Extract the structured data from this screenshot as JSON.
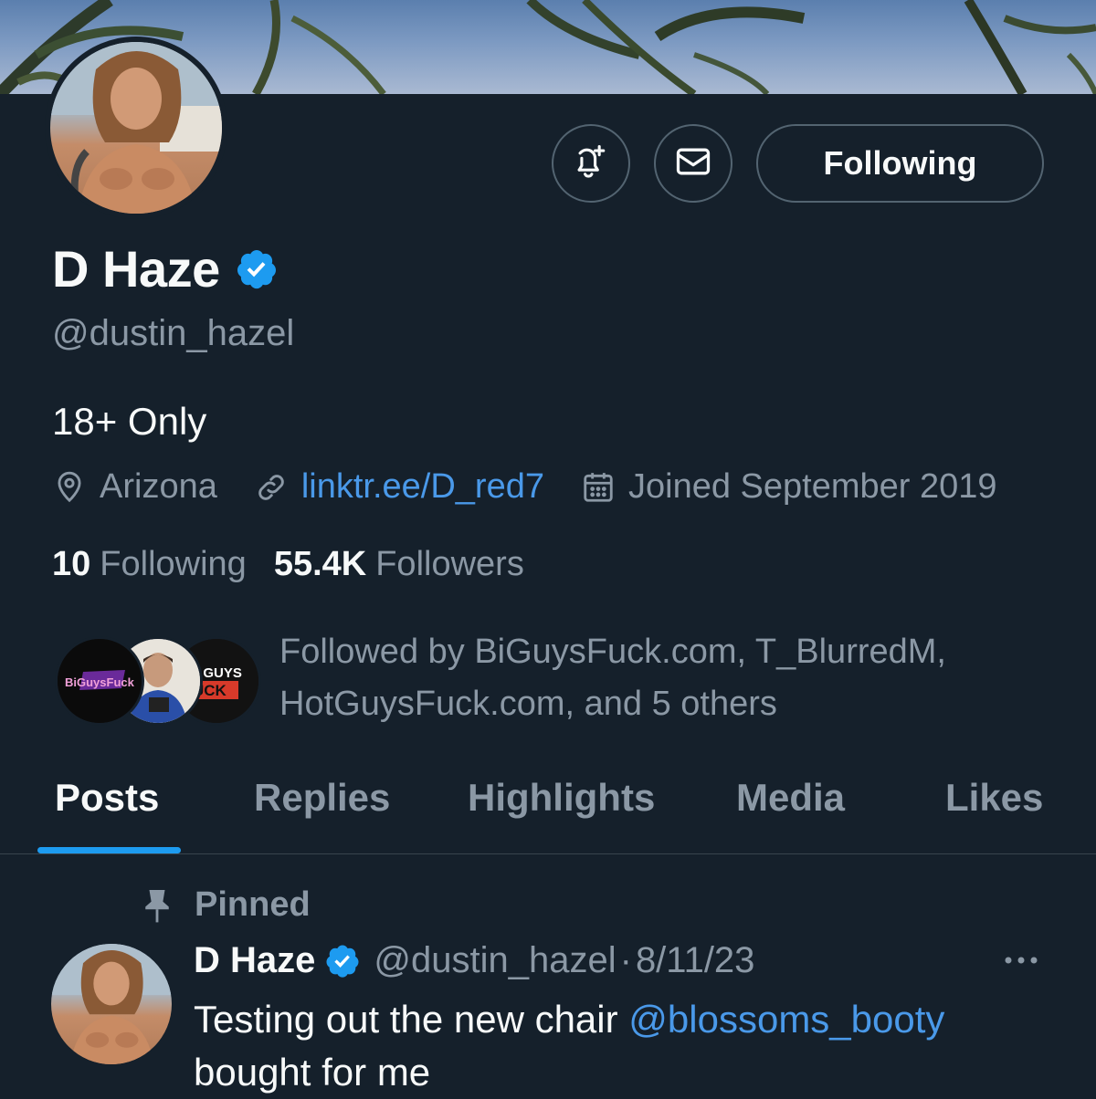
{
  "colors": {
    "background": "#15202b",
    "text_primary": "#f7f9f9",
    "text_secondary": "#8b98a5",
    "accent_blue": "#1d9bf0",
    "link_blue": "#4a99e9",
    "border": "#536471"
  },
  "header": {
    "notify_icon": "bell-plus-icon",
    "message_icon": "envelope-icon",
    "follow_button_label": "Following"
  },
  "profile": {
    "name": "D Haze",
    "verified": true,
    "handle": "@dustin_hazel",
    "bio": "18+ Only",
    "location": "Arizona",
    "link": "linktr.ee/D_red7",
    "joined": "Joined September 2019"
  },
  "stats": {
    "following_count": "10",
    "following_label": "Following",
    "followers_count": "55.4K",
    "followers_label": "Followers"
  },
  "followed_by": {
    "text": "Followed by BiGuysFuck.com, T_BlurredM, HotGuysFuck.com, and 5 others",
    "avatar_texts": [
      "BiGuysFuck",
      "T GUYS",
      "UCK"
    ]
  },
  "tabs": [
    {
      "label": "Posts",
      "active": true
    },
    {
      "label": "Replies",
      "active": false
    },
    {
      "label": "Highlights",
      "active": false
    },
    {
      "label": "Media",
      "active": false
    },
    {
      "label": "Likes",
      "active": false
    }
  ],
  "pinned_post": {
    "pinned_label": "Pinned",
    "author_name": "D Haze",
    "author_handle": "@dustin_hazel",
    "separator": "·",
    "date": "8/11/23",
    "text_before": "Testing out the new chair ",
    "mention": "@blossoms_booty",
    "text_after": " bought for me"
  }
}
